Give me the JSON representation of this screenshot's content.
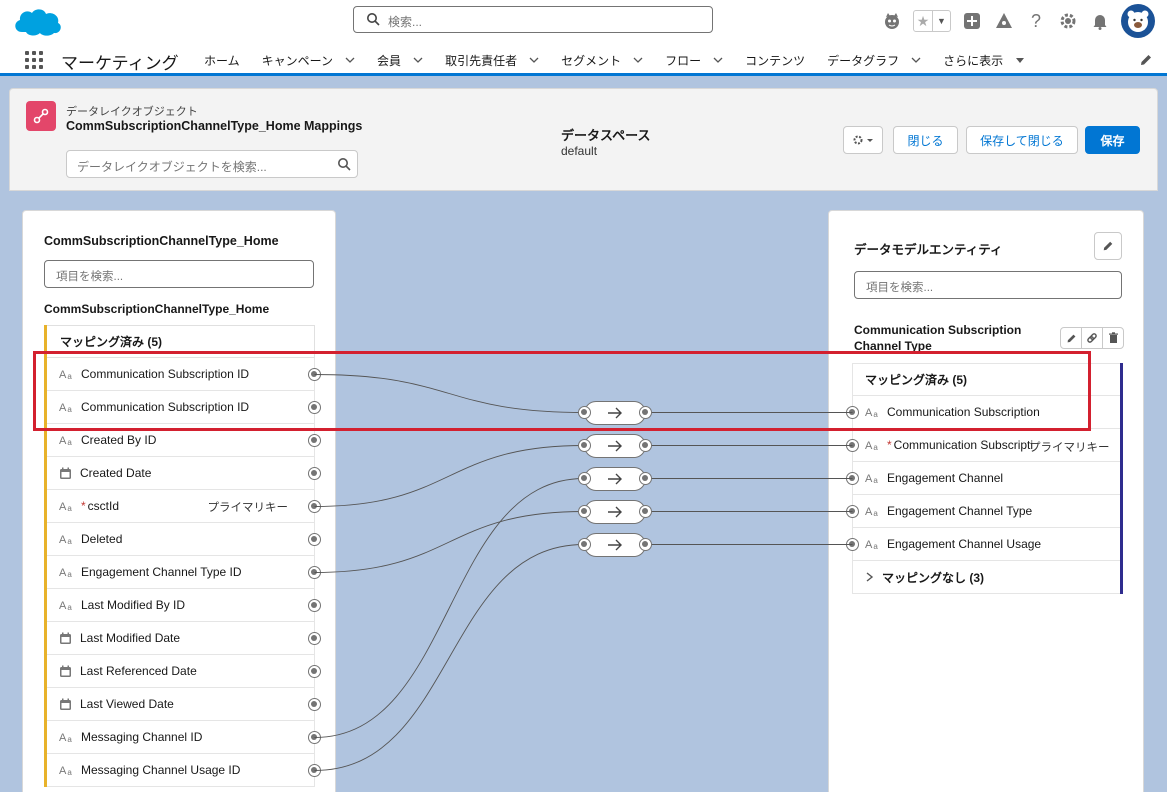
{
  "global": {
    "search_placeholder": "検索...",
    "help": "?"
  },
  "nav": {
    "app_name": "マーケティング",
    "items": [
      {
        "label": "ホーム",
        "chevron": false
      },
      {
        "label": "キャンペーン",
        "chevron": true
      },
      {
        "label": "会員",
        "chevron": true
      },
      {
        "label": "取引先責任者",
        "chevron": true
      },
      {
        "label": "セグメント",
        "chevron": true
      },
      {
        "label": "フロー",
        "chevron": true
      },
      {
        "label": "コンテンツ",
        "chevron": false
      },
      {
        "label": "データグラフ",
        "chevron": true
      },
      {
        "label": "さらに表示",
        "chevron": true
      }
    ]
  },
  "header": {
    "object_type": "データレイクオブジェクト",
    "object_name": "CommSubscriptionChannelType_Home Mappings",
    "object_search_placeholder": "データレイクオブジェクトを検索...",
    "dataspace_label": "データスペース",
    "dataspace_value": "default",
    "close_label": "閉じる",
    "save_close_label": "保存して閉じる",
    "save_label": "保存"
  },
  "left": {
    "title": "CommSubscriptionChannelType_Home",
    "search_placeholder": "項目を検索...",
    "subtitle": "CommSubscriptionChannelType_Home",
    "section_label": "マッピング済み (5)",
    "primary_key_label": "プライマリキー",
    "fields": [
      {
        "label": "Communication Subscription ID",
        "type": "text"
      },
      {
        "label": "Communication Subscription ID",
        "type": "text"
      },
      {
        "label": "Created By ID",
        "type": "text"
      },
      {
        "label": "Created Date",
        "type": "date"
      },
      {
        "label": "csctId",
        "type": "text",
        "required": true,
        "pk": true
      },
      {
        "label": "Deleted",
        "type": "text"
      },
      {
        "label": "Engagement Channel Type ID",
        "type": "text"
      },
      {
        "label": "Last Modified By ID",
        "type": "text"
      },
      {
        "label": "Last Modified Date",
        "type": "date"
      },
      {
        "label": "Last Referenced Date",
        "type": "date"
      },
      {
        "label": "Last Viewed Date",
        "type": "date"
      },
      {
        "label": "Messaging Channel ID",
        "type": "text"
      },
      {
        "label": "Messaging Channel Usage ID",
        "type": "text"
      }
    ]
  },
  "right": {
    "title": "データモデルエンティティ",
    "search_placeholder": "項目を検索...",
    "entity_name": "Communication Subscription Channel Type",
    "mapped_label": "マッピング済み (5)",
    "unmapped_label": "マッピングなし (3)",
    "primary_key_label": "プライマリキー",
    "fields": [
      {
        "label": "Communication Subscription"
      },
      {
        "label": "Communication Subscripti",
        "required": true,
        "pk": true
      },
      {
        "label": "Engagement Channel"
      },
      {
        "label": "Engagement Channel Type"
      },
      {
        "label": "Engagement Channel Usage"
      }
    ]
  },
  "mappings": [
    {
      "from": 0,
      "to": 0
    },
    {
      "from": 4,
      "to": 1
    },
    {
      "from": 11,
      "to": 2
    },
    {
      "from": 6,
      "to": 3
    },
    {
      "from": 12,
      "to": 4
    }
  ],
  "colors": {
    "brand": "#0176d3",
    "highlight": "#d3202f",
    "left_accent": "#e8b22a",
    "right_accent": "#2f2c8e",
    "object_icon": "#e3466a"
  }
}
